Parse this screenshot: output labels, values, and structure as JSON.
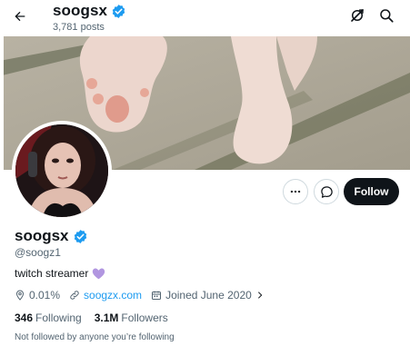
{
  "header": {
    "name": "soogsx",
    "posts_count": "3,781 posts",
    "back_icon": "arrow-left-icon",
    "grok_icon": "grok-icon",
    "search_icon": "search-icon"
  },
  "profile": {
    "display_name": "soogsx",
    "handle": "@soogz1",
    "bio": "twitch streamer",
    "bio_emoji": "purple-heart",
    "location": "0.01%",
    "website": "soogzx.com",
    "joined": "Joined June 2020",
    "following_count": "346",
    "following_label": "Following",
    "followers_count": "3.1M",
    "followers_label": "Followers",
    "not_followed_text": "Not followed by anyone you’re following"
  },
  "actions": {
    "more_icon": "more-icon",
    "message_icon": "message-icon",
    "follow_label": "Follow"
  },
  "colors": {
    "accent": "#1d9bf0",
    "text_primary": "#0f1419",
    "text_secondary": "#536471",
    "follow_bg": "#0f1419",
    "heart": "#b196e0"
  }
}
